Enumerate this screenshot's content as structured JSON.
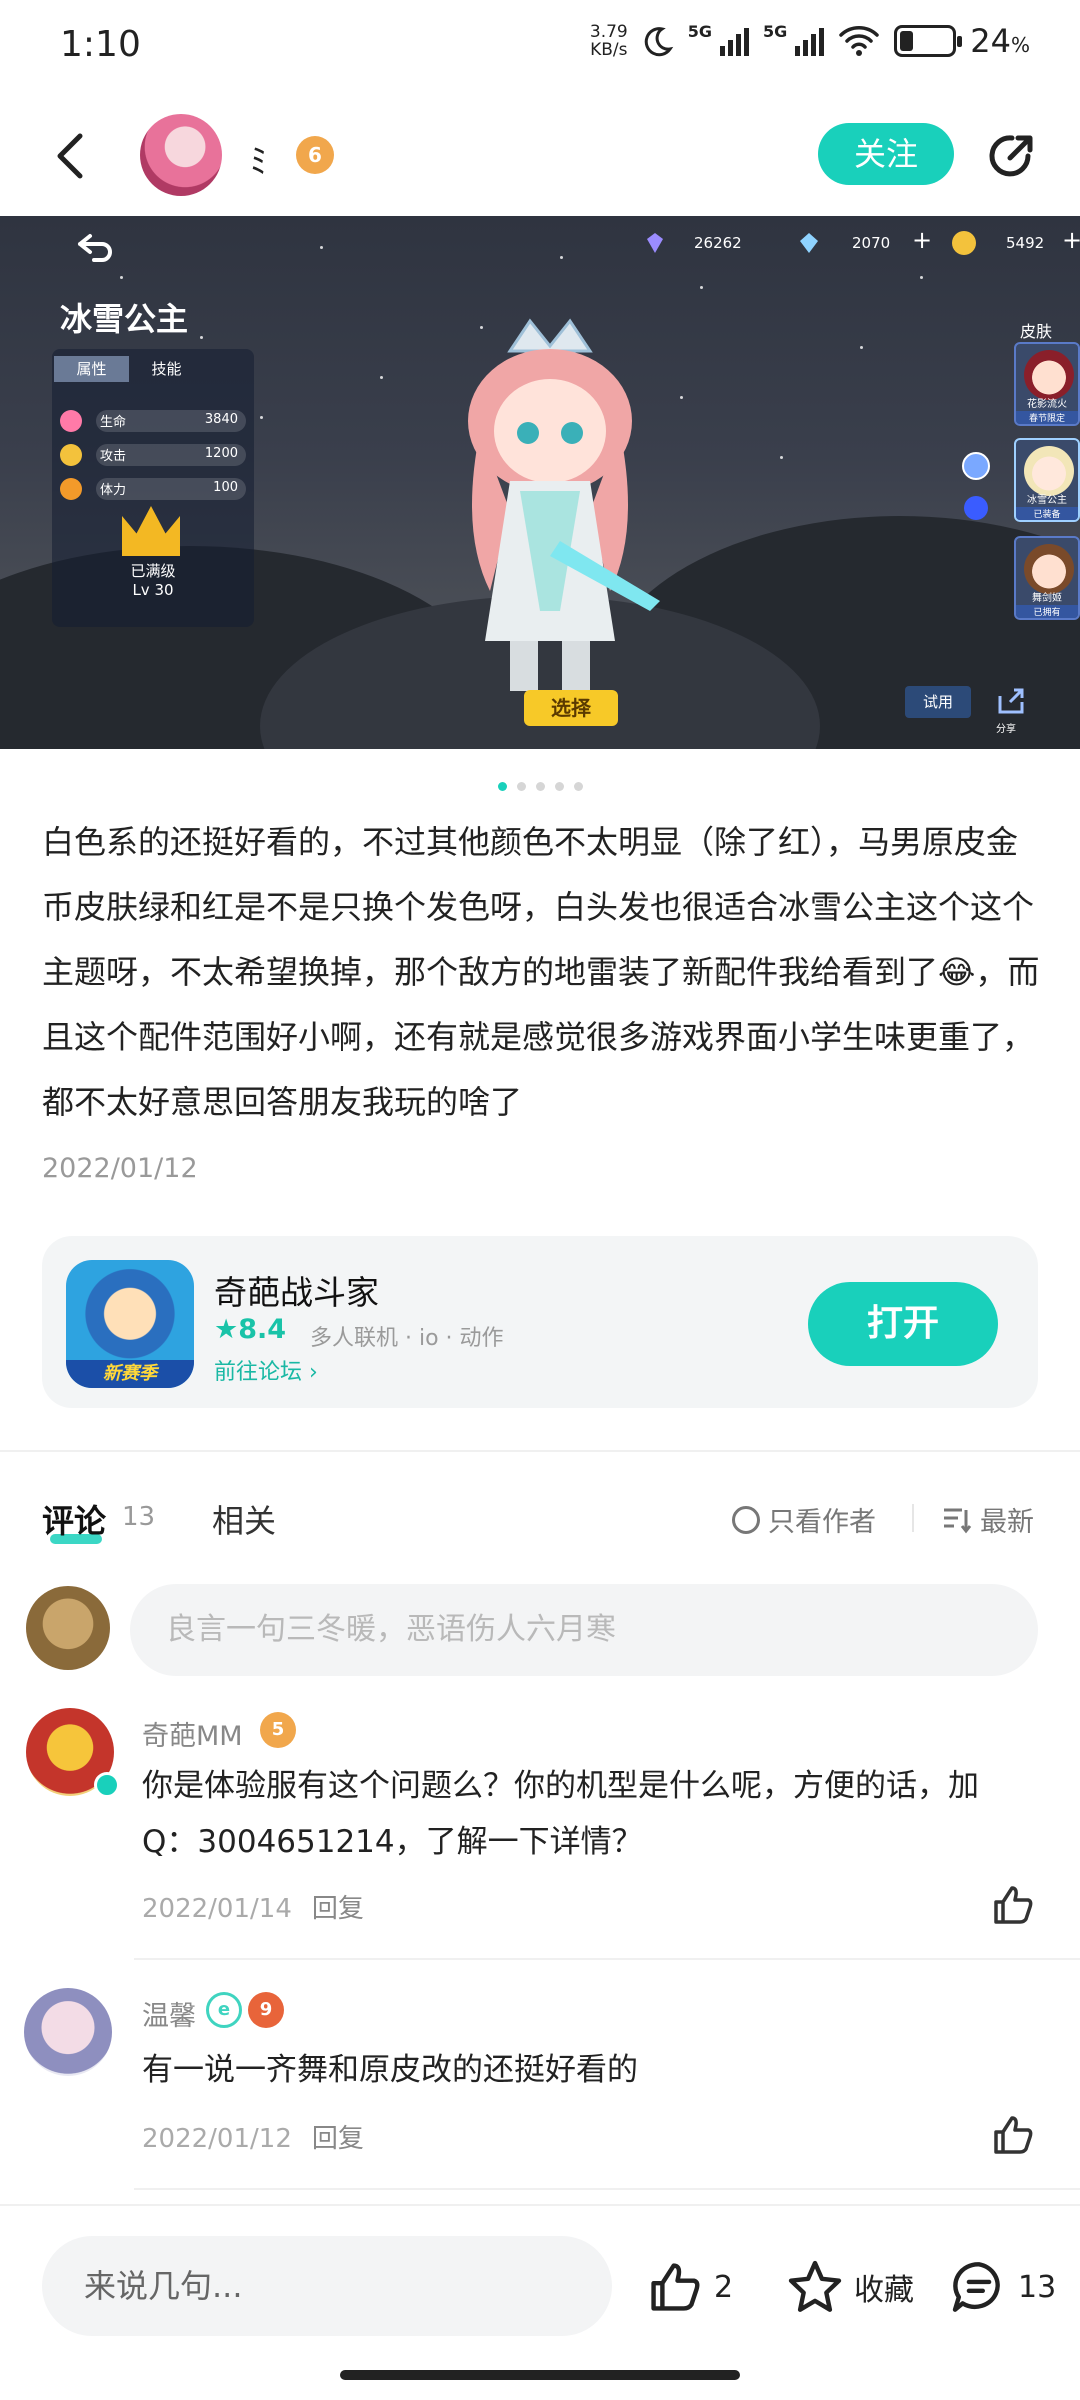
{
  "status_bar": {
    "time": "1:10",
    "net_speed_value": "3.79",
    "net_speed_unit": "KB/s",
    "sim1": "5G",
    "sim2": "5G",
    "battery": "24",
    "battery_unit": "%"
  },
  "header": {
    "username": "ﾐ",
    "level": "6",
    "follow_label": "关注"
  },
  "game_screenshot": {
    "resource1": "26262",
    "resource2": "2070",
    "resource3": "5492",
    "hero_name": "冰雪公主",
    "tab_attr": "属性",
    "tab_skill": "技能",
    "stats": [
      {
        "name": "生命",
        "value": "3840"
      },
      {
        "name": "攻击",
        "value": "1200"
      },
      {
        "name": "体力",
        "value": "100"
      }
    ],
    "maxed": "已满级",
    "lv": "Lv 30",
    "select_label": "选择",
    "try_label": "试用",
    "share_label": "分享",
    "skins_label": "皮肤",
    "skins": [
      {
        "name": "花影流火",
        "tag": "春节限定"
      },
      {
        "name": "冰雪公主",
        "tag": "已装备"
      },
      {
        "name": "舞剑姬",
        "tag": "已拥有"
      }
    ]
  },
  "pager": {
    "count": 5,
    "active": 0
  },
  "post": {
    "text_1": "白色系的还挺好看的，不过其他颜色不太明显（除了红），马男原皮金币皮肤绿和红是不是只换个发色呀，白头发也很适合冰雪公主这个这个主题呀，不太希望换掉，那个敌方的地雷装了新配件我给看到了",
    "emoji": "😂",
    "text_2": "，而且这个配件范围好小啊，还有就是感觉很多游戏界面小学生味更重了，都不太好意思回答朋友我玩的啥了",
    "date": "2022/01/12"
  },
  "game_card": {
    "icon_label": "新赛季",
    "name": "奇葩战斗家",
    "rating": "8.4",
    "tags": "多人联机 · io · 动作",
    "forum_link": "前往论坛",
    "open_label": "打开"
  },
  "tabs": {
    "comments_label": "评论",
    "comments_count": "13",
    "related_label": "相关",
    "only_author_label": "只看作者",
    "sort_label": "最新"
  },
  "comment_input": {
    "placeholder": "良言一句三冬暖，恶语伤人六月寒"
  },
  "comments": [
    {
      "name": "奇葩MM",
      "level": "5",
      "text": "你是体验服有这个问题么？你的机型是什么呢，方便的话，加Q：3004651214，了解一下详情？",
      "date": "2022/01/14",
      "reply_label": "回复"
    },
    {
      "name": "温馨",
      "level": "9",
      "text": "有一说一齐舞和原皮改的还挺好看的",
      "date": "2022/01/12",
      "reply_label": "回复"
    }
  ],
  "bottom_bar": {
    "say_placeholder": "来说几句...",
    "likes": "2",
    "favorite_label": "收藏",
    "comments": "13"
  },
  "colors": {
    "accent": "#19d0bb",
    "badge_orange": "#f1a74c"
  }
}
